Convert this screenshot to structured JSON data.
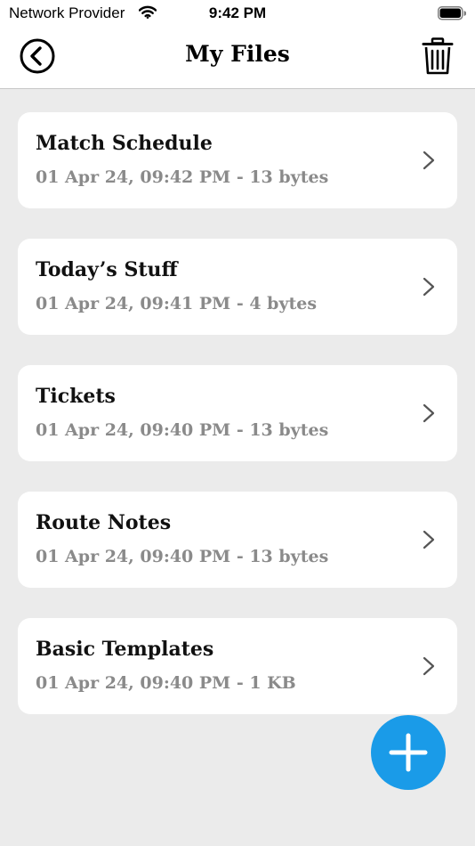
{
  "status_bar": {
    "carrier": "Network Provider",
    "time": "9:42 PM",
    "wifi_icon": "wifi-icon",
    "battery_icon": "battery-icon"
  },
  "nav": {
    "title": "My Files",
    "back_icon": "back-circle-icon",
    "trash_icon": "trash-icon"
  },
  "files": [
    {
      "name": "Match Schedule",
      "meta": "01 Apr 24, 09:42 PM - 13 bytes"
    },
    {
      "name": "Today’s Stuff",
      "meta": "01 Apr 24, 09:41 PM - 4 bytes"
    },
    {
      "name": "Tickets",
      "meta": "01 Apr 24, 09:40 PM - 13 bytes"
    },
    {
      "name": "Route Notes",
      "meta": "01 Apr 24, 09:40 PM - 13 bytes"
    },
    {
      "name": "Basic Templates",
      "meta": "01 Apr 24, 09:40 PM - 1 KB"
    }
  ],
  "fab": {
    "icon": "plus-icon",
    "color": "#1a9be8"
  },
  "colors": {
    "background": "#ebebeb",
    "card": "#ffffff",
    "meta_text": "#8a8a8a",
    "accent": "#1a9be8"
  }
}
